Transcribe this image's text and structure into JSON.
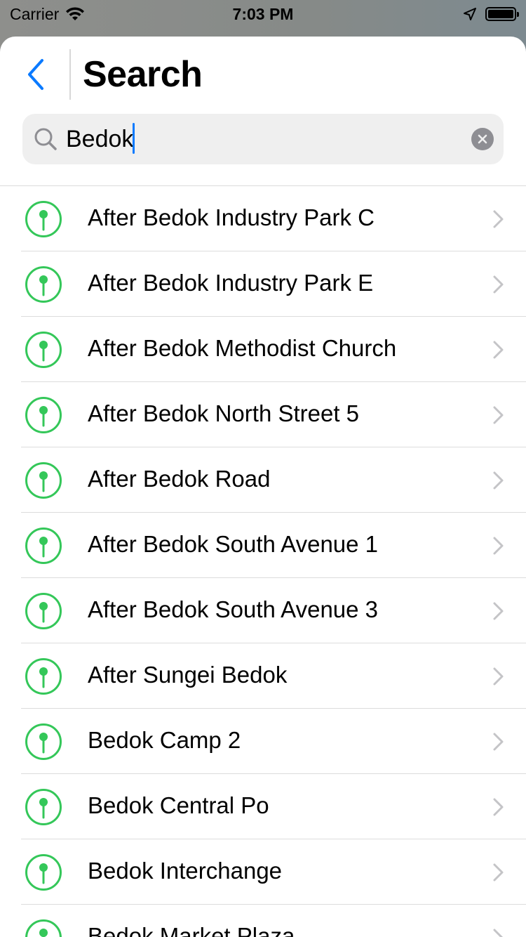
{
  "status_bar": {
    "carrier": "Carrier",
    "time": "7:03 PM"
  },
  "header": {
    "title": "Search"
  },
  "search": {
    "value": "Bedok"
  },
  "colors": {
    "accent": "#0a7aff",
    "pin": "#34c759"
  },
  "results": [
    {
      "label": "After Bedok Industry Park C"
    },
    {
      "label": "After Bedok Industry Park E"
    },
    {
      "label": "After Bedok Methodist Church"
    },
    {
      "label": "After Bedok North Street 5"
    },
    {
      "label": "After Bedok Road"
    },
    {
      "label": "After Bedok South Avenue 1"
    },
    {
      "label": "After Bedok South Avenue 3"
    },
    {
      "label": "After Sungei Bedok"
    },
    {
      "label": "Bedok Camp 2"
    },
    {
      "label": "Bedok Central Po"
    },
    {
      "label": "Bedok Interchange"
    },
    {
      "label": "Bedok Market Plaza"
    }
  ]
}
